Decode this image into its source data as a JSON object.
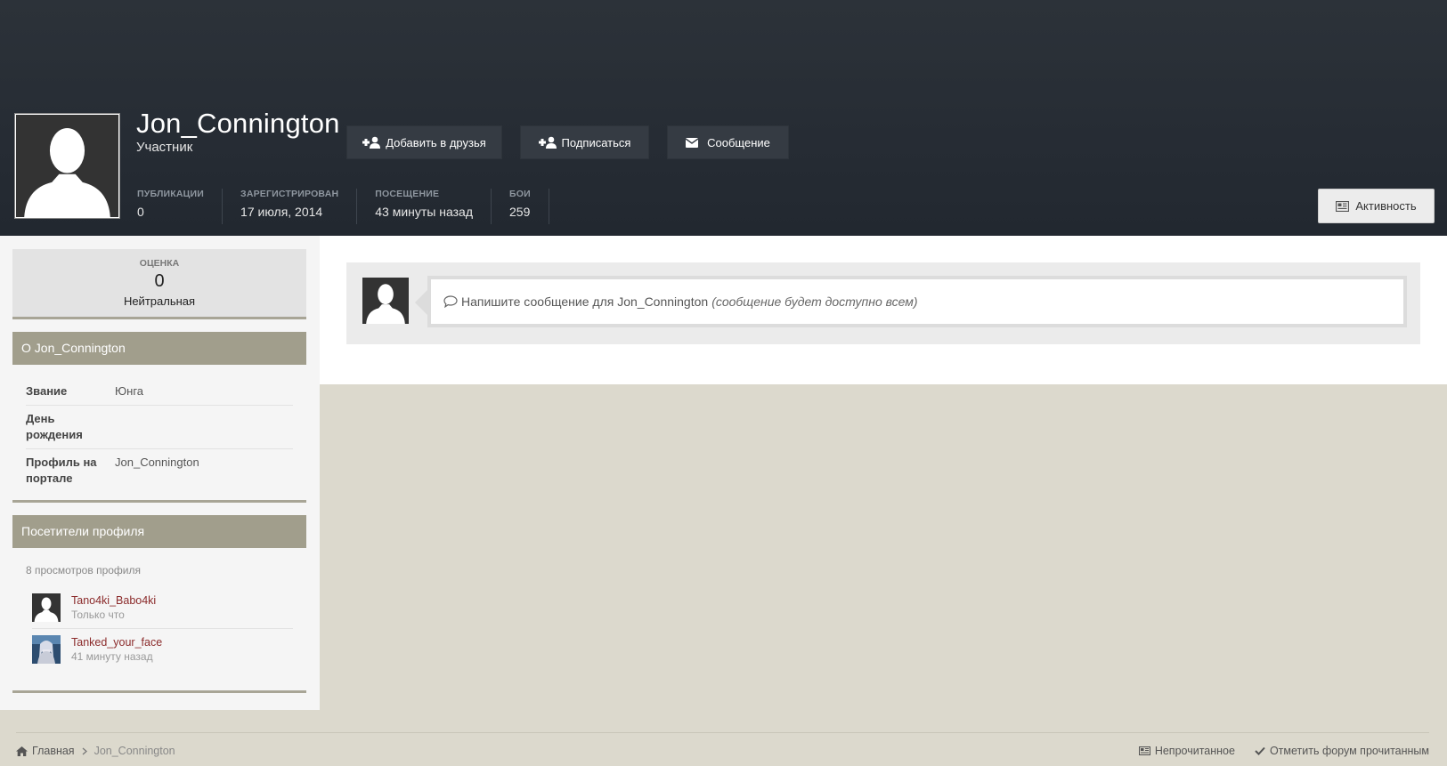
{
  "profile": {
    "name": "Jon_Connington",
    "role": "Участник",
    "buttons": {
      "add_friend": "Добавить в друзья",
      "follow": "Подписаться",
      "message": "Сообщение",
      "activity": "Активность"
    },
    "stats": [
      {
        "label": "ПУБЛИКАЦИИ",
        "value": "0"
      },
      {
        "label": "ЗАРЕГИСТРИРОВАН",
        "value": "17 июля, 2014"
      },
      {
        "label": "ПОСЕЩЕНИЕ",
        "value": "43 минуты назад"
      },
      {
        "label": "БОИ",
        "value": "259"
      }
    ]
  },
  "rating": {
    "label": "ОЦЕНКА",
    "value": "0",
    "text": "Нейтральная"
  },
  "about": {
    "title": "О Jon_Connington",
    "rows": [
      {
        "key": "Звание",
        "value": "Юнга"
      },
      {
        "key": "День рождения",
        "value": ""
      },
      {
        "key": "Профиль на портале",
        "value": "Jon_Connington"
      }
    ]
  },
  "visitors": {
    "title": "Посетители профиля",
    "views": "8 просмотров профиля",
    "items": [
      {
        "name": "Tano4ki_Babo4ki",
        "time": "Только что"
      },
      {
        "name": "Tanked_your_face",
        "time": "41 минуту назад"
      }
    ]
  },
  "composer": {
    "placeholder": "Напишите сообщение для Jon_Connington",
    "note": "(сообщение будет доступно всем)"
  },
  "footer": {
    "home": "Главная",
    "current": "Jon_Connington",
    "unread": "Непрочитанное",
    "mark_read": "Отметить форум прочитанным"
  },
  "colors": {
    "header_bg": "#262c34",
    "accent": "#a19e8c",
    "link": "#8b2b2b",
    "page_bg": "#dcd9cd"
  }
}
